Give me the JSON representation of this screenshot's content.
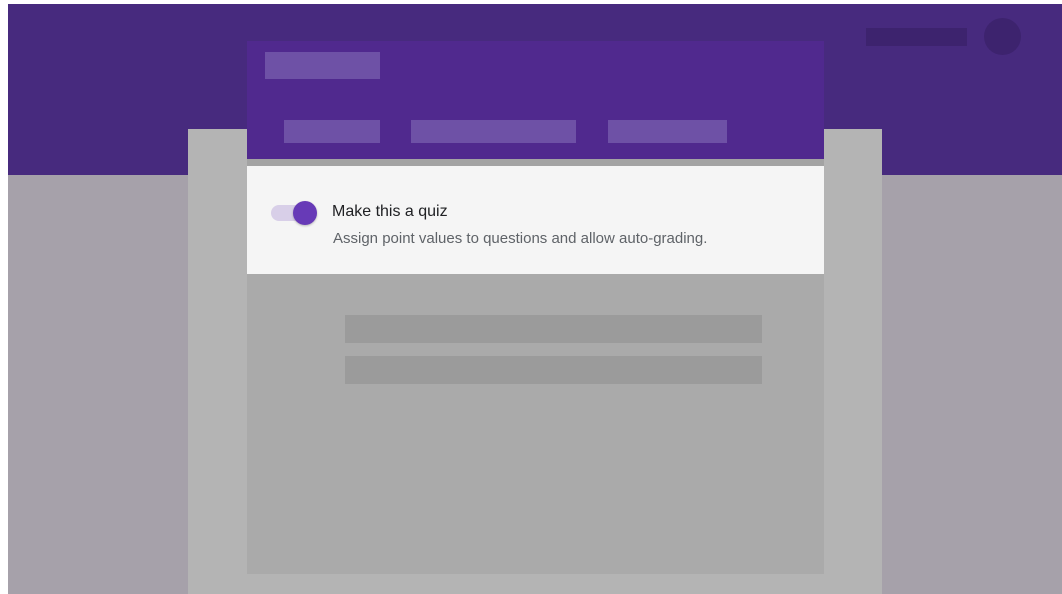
{
  "colors": {
    "top_band": "#472a7e",
    "form_header": "#50298e",
    "placeholder": "#6e51a6",
    "toggle_accent": "#673ab7",
    "toggle_track": "#d8cfe8",
    "panel_background": "#f5f5f5",
    "page_background": "#a6a1aa"
  },
  "quiz_setting": {
    "toggle_state": "on",
    "title": "Make this a quiz",
    "description": "Assign point values to questions and allow auto-grading."
  }
}
